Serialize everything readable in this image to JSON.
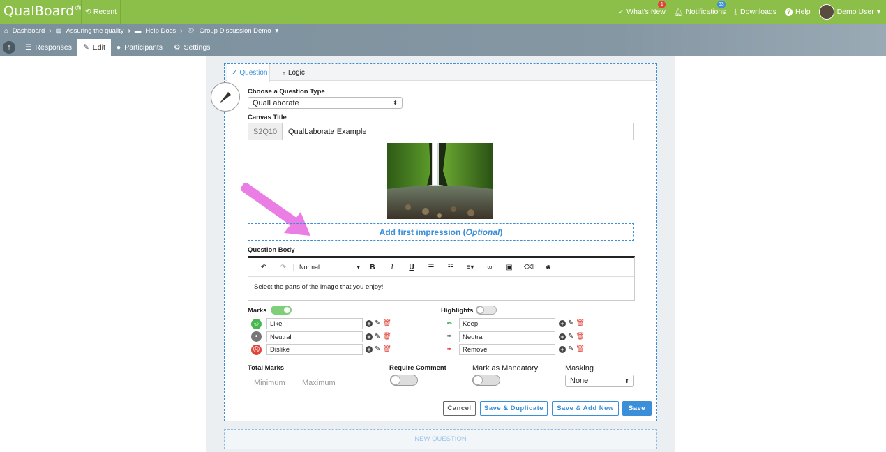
{
  "brand": {
    "logo": "QualBoard",
    "reg": "®"
  },
  "topbar": {
    "recent": "Recent",
    "whats_new": "What's New",
    "whats_new_badge": "1",
    "notifications": "Notifications",
    "notifications_badge": "63",
    "downloads": "Downloads",
    "help": "Help",
    "user": "Demo User",
    "colors": {
      "bar": "#8cbe4a",
      "badge_red": "#e0443b",
      "badge_blue": "#3a8fd8"
    }
  },
  "breadcrumb": {
    "items": [
      "Dashboard",
      "Assuring the quality",
      "Help Docs",
      "Group Discussion Demo"
    ]
  },
  "tabs": [
    "Responses",
    "Edit",
    "Participants",
    "Settings"
  ],
  "question": {
    "tabs": [
      "Question",
      "Logic"
    ],
    "type_label": "Choose a Question Type",
    "type_value": "QualLaborate",
    "canvas_title_label": "Canvas Title",
    "canvas_code": "S2Q10",
    "canvas_title": "QualLaborate Example",
    "impression_prefix": "Add first impression (",
    "impression_optional": "Optional",
    "impression_suffix": ")",
    "body_label": "Question Body",
    "editor_format": "Normal",
    "body_text": "Select the parts of the image that you enjoy!",
    "marks_label": "Marks",
    "marks": [
      "Like",
      "Neutral",
      "Dislike"
    ],
    "highlights_label": "Highlights",
    "highlights": [
      "Keep",
      "Neutral",
      "Remove"
    ],
    "total_marks_label": "Total Marks",
    "min_placeholder": "Minimum",
    "max_placeholder": "Maximum",
    "require_comment_label": "Require Comment",
    "mandatory_label": "Mark as Mandatory",
    "masking_label": "Masking",
    "masking_value": "None",
    "buttons": {
      "cancel": "Cancel",
      "save_duplicate": "Save & Duplicate",
      "save_add_new": "Save & Add New",
      "save": "Save"
    }
  },
  "new_question": "NEW QUESTION",
  "colors": {
    "accent": "#3a8fd8",
    "like": "#47b84f",
    "neutral": "#777777",
    "dislike": "#e0443b",
    "arrow": "#ea7ee5"
  }
}
